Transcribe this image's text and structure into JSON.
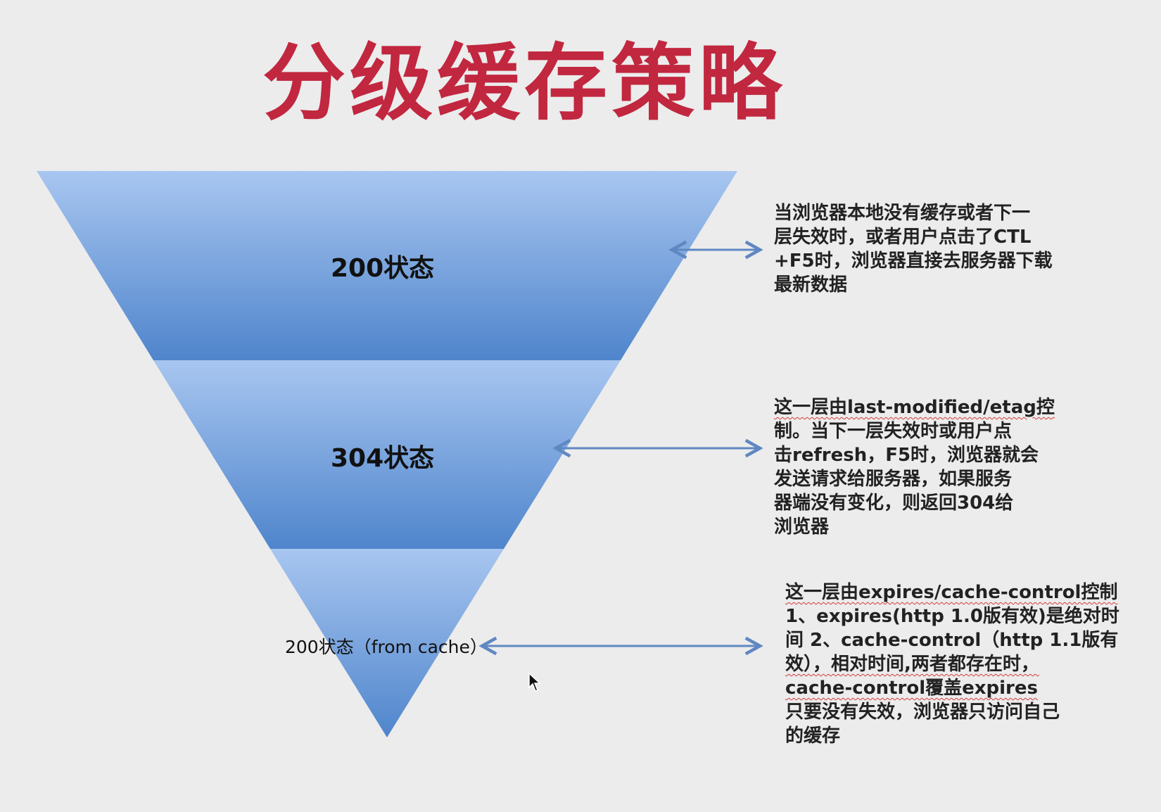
{
  "title": "分级缓存策略",
  "layers": [
    {
      "label": "200状态"
    },
    {
      "label": "304状态"
    },
    {
      "label": "200状态（from cache）"
    }
  ],
  "notes": [
    {
      "lines": [
        "当浏览器本地没有缓存或者下一",
        "层失效时，或者用户点击了CTL",
        "+F5时，浏览器直接去服务器下载",
        "最新数据"
      ]
    },
    {
      "lines": [
        "这一层由last-modified/etag控",
        "制。当下一层失效时或用户点",
        "击refresh，F5时，浏览器就会",
        "发送请求给服务器，如果服务",
        "器端没有变化，则返回304给",
        "浏览器"
      ]
    },
    {
      "lines": [
        "这一层由expires/cache-control控制",
        "1、expires(http 1.0版有效)是绝对时",
        "间  2、cache-control（http 1.1版有",
        "效），相对时间,两者都存在时，",
        "cache-control覆盖expires",
        "只要没有失效，浏览器只访问自己",
        "的缓存"
      ]
    }
  ],
  "colors": {
    "title": "#c1273f",
    "funnel_top": "#a6c4ee",
    "funnel_bottom": "#4f84cc",
    "arrow": "#5f88c2"
  }
}
